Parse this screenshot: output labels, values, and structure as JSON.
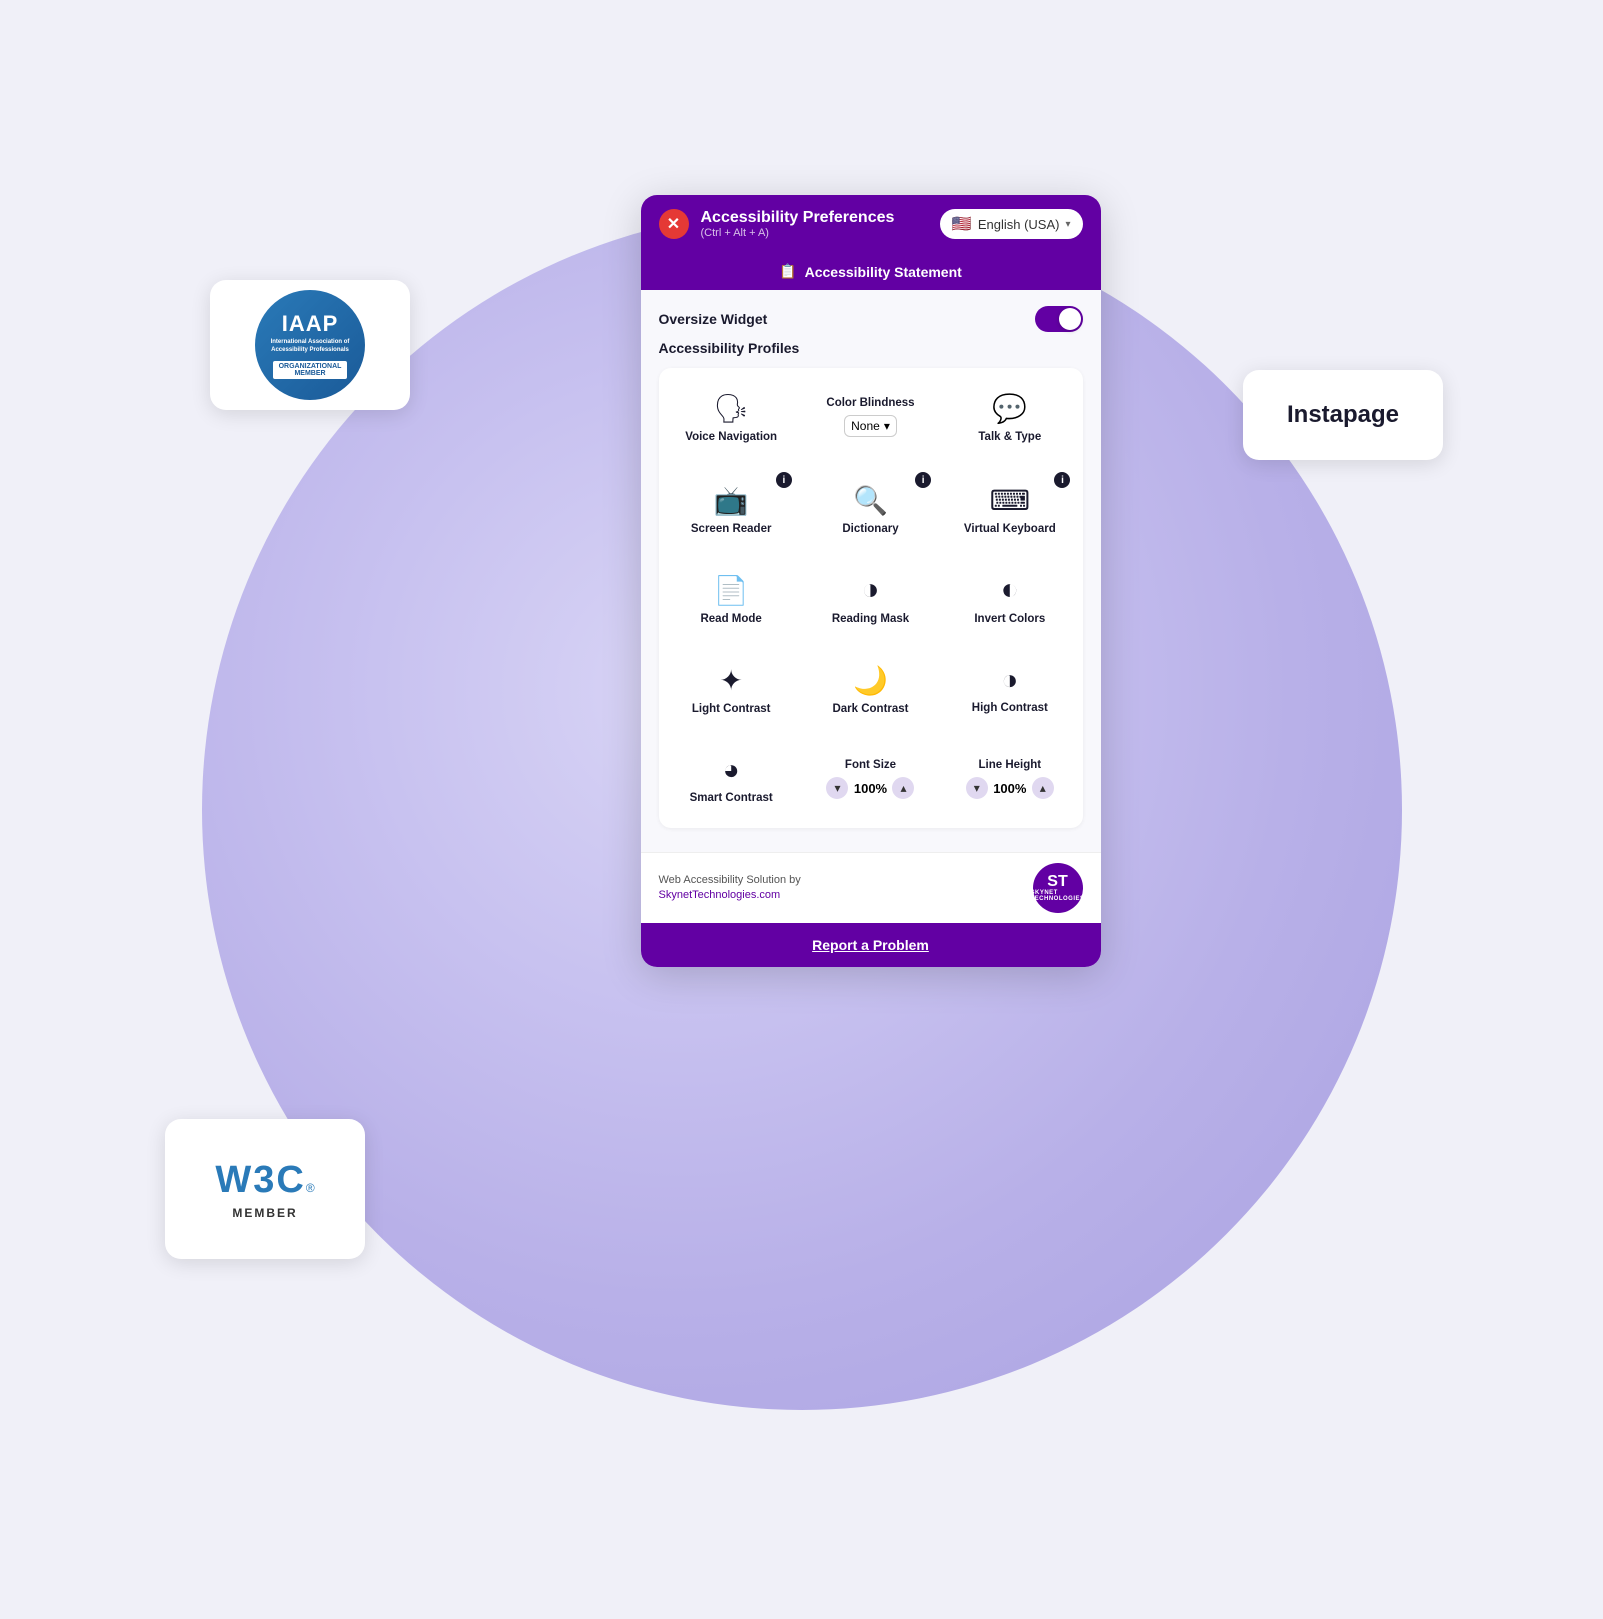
{
  "background": {
    "circle_gradient_start": "#d8d4f5",
    "circle_gradient_end": "#a8a0e0"
  },
  "iaap_badge": {
    "title": "IAAP",
    "subtitle": "International Association of Accessibility Professionals",
    "org_label": "ORGANIZATIONAL",
    "member_label": "MEMBER"
  },
  "w3c_badge": {
    "logo": "W3C",
    "registered": "®",
    "member_label": "MEMBER"
  },
  "instapage": {
    "text": "Instapage"
  },
  "panel": {
    "header": {
      "close_label": "✕",
      "title": "Accessibility Preferences",
      "shortcut": "(Ctrl + Alt + A)",
      "lang_label": "English (USA)",
      "lang_chevron": "▾"
    },
    "stmt_bar": {
      "icon": "📋",
      "label": "Accessibility Statement"
    },
    "oversize_widget": {
      "label": "Oversize Widget"
    },
    "accessibility_profiles": {
      "label": "Accessibility Profiles"
    },
    "features": {
      "voice_navigation": {
        "label": "Voice Navigation",
        "icon": "🗣"
      },
      "color_blindness": {
        "label": "Color Blindness",
        "dropdown_value": "None"
      },
      "talk_type": {
        "label": "Talk & Type",
        "icon": "💬"
      },
      "screen_reader": {
        "label": "Screen Reader",
        "icon": "📺",
        "has_info": true
      },
      "dictionary": {
        "label": "Dictionary",
        "icon": "🔍",
        "has_info": true
      },
      "virtual_keyboard": {
        "label": "Virtual Keyboard",
        "icon": "⌨",
        "has_info": true
      },
      "read_mode": {
        "label": "Read Mode",
        "icon": "📄"
      },
      "reading_mask": {
        "label": "Reading Mask",
        "icon": "◑"
      },
      "invert_colors": {
        "label": "Invert Colors",
        "icon": "◐"
      },
      "light_contrast": {
        "label": "Light Contrast",
        "icon": "✦"
      },
      "dark_contrast": {
        "label": "Dark Contrast",
        "icon": "🌙"
      },
      "high_contrast": {
        "label": "High Contrast",
        "icon": "◑"
      },
      "smart_contrast": {
        "label": "Smart Contrast",
        "icon": "◕"
      },
      "font_size": {
        "label": "Font Size",
        "value": "100%"
      },
      "line_height": {
        "label": "Line Height",
        "value": "100%"
      }
    },
    "footer": {
      "text_line1": "Web Accessibility Solution by",
      "text_line2": "SkynetTechnologies.com",
      "st_label": "ST",
      "skynet_label": "SKYNET\nTECHNOLOGIES"
    },
    "report_btn": {
      "label": "Report a Problem"
    }
  }
}
